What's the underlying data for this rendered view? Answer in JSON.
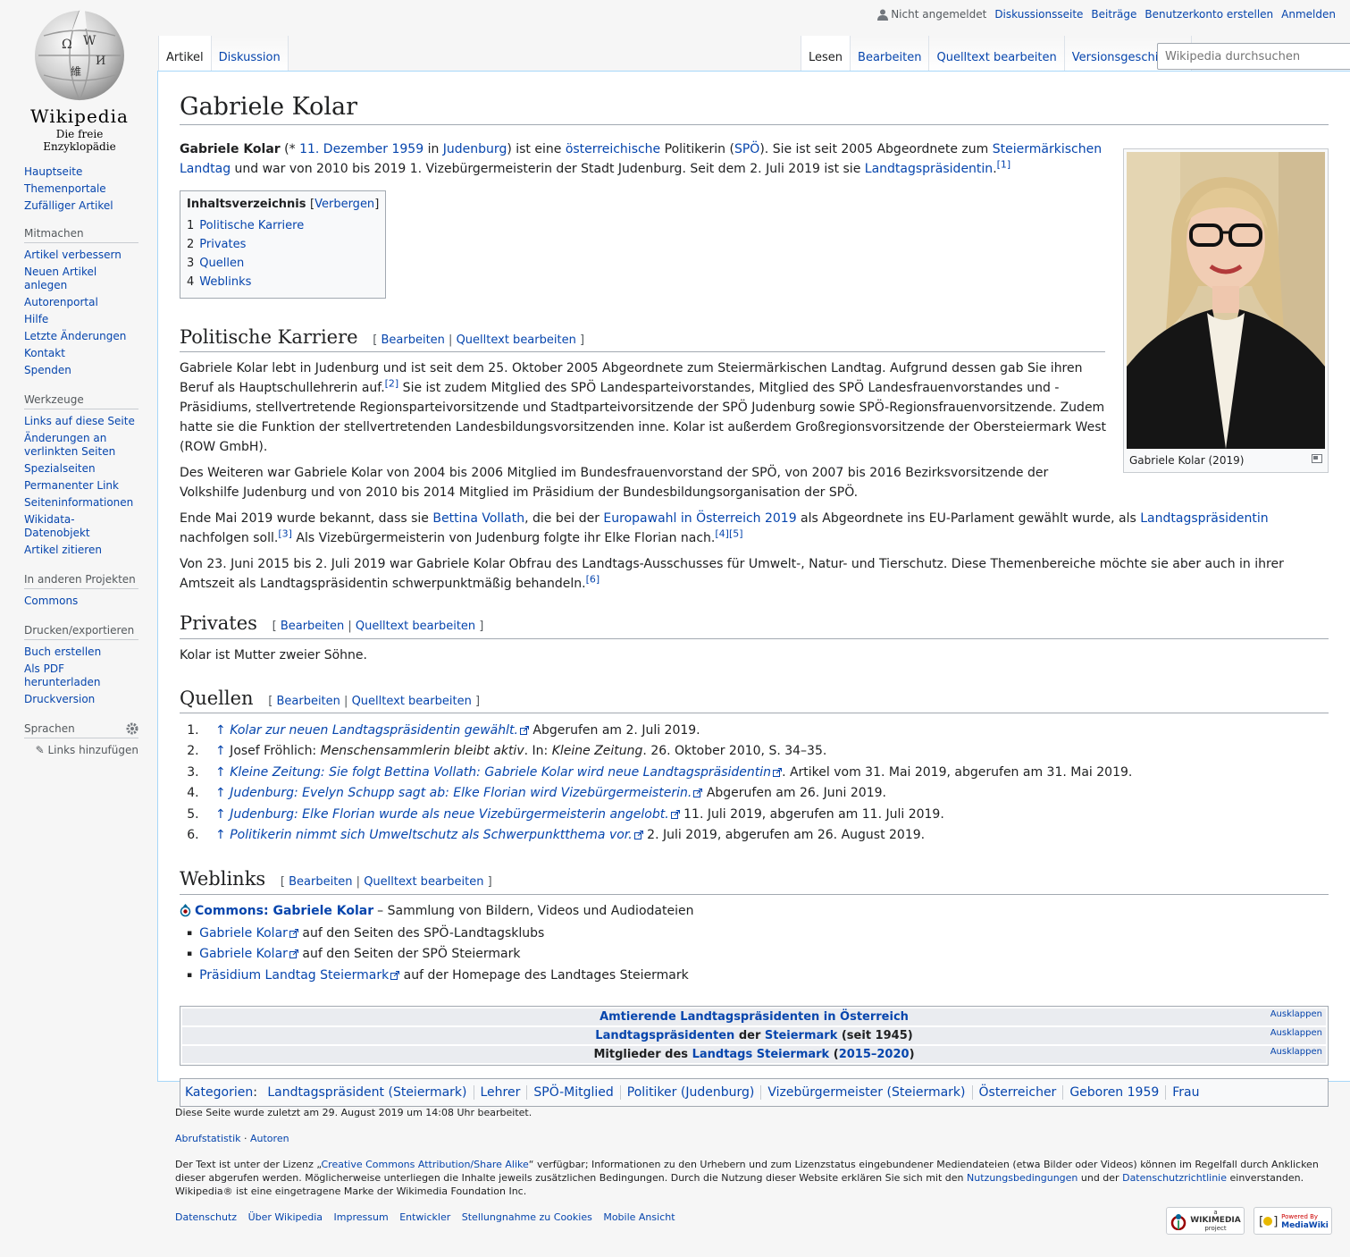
{
  "logo": {
    "wordmark": "Wikipedia",
    "tagline": "Die freie Enzyklopädie"
  },
  "personal": {
    "anon": "Nicht angemeldet",
    "links": [
      "Diskussionsseite",
      "Beiträge",
      "Benutzerkonto erstellen",
      "Anmelden"
    ]
  },
  "tabs_left": [
    "Artikel",
    "Diskussion"
  ],
  "tabs_right": [
    "Lesen",
    "Bearbeiten",
    "Quelltext bearbeiten",
    "Versionsgeschichte"
  ],
  "search": {
    "placeholder": "Wikipedia durchsuchen"
  },
  "sidebar": {
    "nav": [
      "Hauptseite",
      "Themenportale",
      "Zufälliger Artikel"
    ],
    "mitmachen": {
      "heading": "Mitmachen",
      "items": [
        "Artikel verbessern",
        "Neuen Artikel anlegen",
        "Autorenportal",
        "Hilfe",
        "Letzte Änderungen",
        "Kontakt",
        "Spenden"
      ]
    },
    "werkzeuge": {
      "heading": "Werkzeuge",
      "items": [
        "Links auf diese Seite",
        "Änderungen an verlinkten Seiten",
        "Spezialseiten",
        "Permanenter Link",
        "Seiteninformationen",
        "Wikidata-Datenobjekt",
        "Artikel zitieren"
      ]
    },
    "projekte": {
      "heading": "In anderen Projekten",
      "items": [
        "Commons"
      ]
    },
    "drucken": {
      "heading": "Drucken/exportieren",
      "items": [
        "Buch erstellen",
        "Als PDF herunterladen",
        "Druckversion"
      ]
    },
    "sprachen": {
      "heading": "Sprachen",
      "add": "Links hinzufügen"
    }
  },
  "article": {
    "title": "Gabriele Kolar",
    "intro": {
      "bold": "Gabriele Kolar",
      "t1": " (* ",
      "l1": "11. Dezember 1959",
      "t2": " in ",
      "l2": "Judenburg",
      "t3": ") ist eine ",
      "l3": "österreichische",
      "t4": " Politikerin (",
      "l4": "SPÖ",
      "t5": "). Sie ist seit 2005 Abgeordnete zum ",
      "l5": "Steiermärkischen Landtag",
      "t6": " und war von 2010 bis 2019 1. Vizebürgermeisterin der Stadt Judenburg. Seit dem 2. Juli 2019 ist sie ",
      "l6": "Landtagspräsidentin",
      "t7": ".",
      "ref": "[1]"
    },
    "image_caption": "Gabriele Kolar (2019)",
    "toc": {
      "title": "Inhaltsverzeichnis",
      "toggle": "Verbergen",
      "items": [
        {
          "num": "1",
          "label": "Politische Karriere"
        },
        {
          "num": "2",
          "label": "Privates"
        },
        {
          "num": "3",
          "label": "Quellen"
        },
        {
          "num": "4",
          "label": "Weblinks"
        }
      ]
    },
    "edit": {
      "open": "[ ",
      "edit": "Bearbeiten",
      "sep": " | ",
      "source": "Quelltext bearbeiten",
      "close": " ]"
    },
    "sections": {
      "karriere": {
        "title": "Politische Karriere",
        "p1a": "Gabriele Kolar lebt in Judenburg und ist seit dem 25. Oktober 2005 Abgeordnete zum Steiermärkischen Landtag. Aufgrund dessen gab Sie ihren Beruf als Hauptschullehrerin auf.",
        "p1ref": "[2]",
        "p1b": " Sie ist zudem Mitglied des SPÖ Landesparteivorstandes, Mitglied des SPÖ Landesfrauenvorstandes und -Präsidiums, stellvertretende Regionsparteivorsitzende und Stadtparteivorsitzende der SPÖ Judenburg sowie SPÖ-Regionsfrauenvorsitzende. Zudem hatte sie die Funktion der stellvertretenden Landesbildungsvorsitzenden inne. Kolar ist außerdem Großregionsvorsitzende der Obersteiermark West (ROW GmbH).",
        "p2": "Des Weiteren war Gabriele Kolar von 2004 bis 2006 Mitglied im Bundesfrauenvorstand der SPÖ, von 2007 bis 2016 Bezirksvorsitzende der Volkshilfe Judenburg und von 2010 bis 2014 Mitglied im Präsidium der Bundesbildungsorganisation der SPÖ.",
        "p3a": "Ende Mai 2019 wurde bekannt, dass sie ",
        "p3l1": "Bettina Vollath",
        "p3b": ", die bei der ",
        "p3l2": "Europawahl in Österreich 2019",
        "p3c": " als Abgeordnete ins EU-Parlament gewählt wurde, als ",
        "p3l3": "Landtagspräsidentin",
        "p3d": " nachfolgen soll.",
        "p3ref1": "[3]",
        "p3e": " Als Vizebürgermeisterin von Judenburg folgte ihr Elke Florian nach.",
        "p3ref2": "[4]",
        "p3ref3": "[5]",
        "p4": "Von 23. Juni 2015 bis 2. Juli 2019 war Gabriele Kolar Obfrau des Landtags-Ausschusses für Umwelt-, Natur- und Tierschutz. Diese Themenbereiche möchte sie aber auch in ihrer Amtszeit als Landtagspräsidentin schwerpunktmäßig behandeln.",
        "p4ref": "[6]"
      },
      "privates": {
        "title": "Privates",
        "text": "Kolar ist Mutter zweier Söhne."
      },
      "quellen": {
        "title": "Quellen",
        "refs": [
          {
            "arrow": "↑",
            "link": "Kolar zur neuen Landtagspräsidentin gewählt.",
            "rest": " Abgerufen am 2. Juli 2019."
          },
          {
            "arrow": "↑",
            "plain1": " Josef Fröhlich: ",
            "it1": "Menschensammlerin bleibt aktiv",
            "plain2": ". In: ",
            "it2": "Kleine Zeitung",
            "plain3": ". 26. Oktober 2010, S. 34–35."
          },
          {
            "arrow": "↑",
            "link": "Kleine Zeitung: Sie folgt Bettina Vollath: Gabriele Kolar wird neue Landtagspräsidentin",
            "rest": ". Artikel vom 31. Mai 2019, abgerufen am 31. Mai 2019."
          },
          {
            "arrow": "↑",
            "link": "Judenburg: Evelyn Schupp sagt ab: Elke Florian wird Vizebürgermeisterin.",
            "rest": " Abgerufen am 26. Juni 2019."
          },
          {
            "arrow": "↑",
            "link": "Judenburg: Elke Florian wurde als neue Vizebürgermeisterin angelobt.",
            "rest": " 11. Juli 2019, abgerufen am 11. Juli 2019."
          },
          {
            "arrow": "↑",
            "link": "Politikerin nimmt sich Umweltschutz als Schwerpunktthema vor.",
            "rest": " 2. Juli 2019, abgerufen am 26. August 2019."
          }
        ]
      },
      "weblinks": {
        "title": "Weblinks",
        "commons_link": "Commons: Gabriele Kolar",
        "commons_rest": " – Sammlung von Bildern, Videos und Audiodateien",
        "items": [
          {
            "link": "Gabriele Kolar",
            "rest": " auf den Seiten des SPÖ-Landtagsklubs"
          },
          {
            "link": "Gabriele Kolar",
            "rest": " auf den Seiten der SPÖ Steiermark"
          },
          {
            "link": "Präsidium Landtag Steiermark",
            "rest": " auf der Homepage des Landtages Steiermark"
          }
        ]
      }
    },
    "navboxes": {
      "toggle": "Ausklappen",
      "nb1": "Amtierende Landtagspräsidenten in Österreich",
      "nb2": {
        "l1": "Landtagspräsidenten",
        "t1": " der ",
        "l2": "Steiermark",
        "t2": " (seit 1945)"
      },
      "nb3": {
        "t1": "Mitglieder des ",
        "l1": "Landtags Steiermark",
        "t2": " (",
        "l2": "2015–2020",
        "t3": ")"
      }
    },
    "categories": {
      "label": "Kategorien",
      "colon": ":",
      "items": [
        "Landtagspräsident (Steiermark)",
        "Lehrer",
        "SPÖ-Mitglied",
        "Politiker (Judenburg)",
        "Vizebürgermeister (Steiermark)",
        "Österreicher",
        "Geboren 1959",
        "Frau"
      ]
    }
  },
  "footer": {
    "lastmod": "Diese Seite wurde zuletzt am 29. August 2019 um 14:08 Uhr bearbeitet.",
    "stats": "Abrufstatistik",
    "dot": " · ",
    "authors": "Autoren",
    "license1": "Der Text ist unter der Lizenz „",
    "license_link": "Creative Commons Attribution/Share Alike",
    "license2": "“ verfügbar; Informationen zu den Urhebern und zum Lizenzstatus eingebundener Mediendateien (etwa Bilder oder Videos) können im Regelfall durch Anklicken dieser abgerufen werden. Möglicherweise unterliegen die Inhalte jeweils zusätzlichen Bedingungen. Durch die Nutzung dieser Website erklären Sie sich mit den ",
    "terms": "Nutzungsbedingungen",
    "license3": " und der ",
    "privacy_link": "Datenschutzrichtlinie",
    "license4": " einverstanden.",
    "trademark": "Wikipedia® ist eine eingetragene Marke der Wikimedia Foundation Inc.",
    "links": [
      "Datenschutz",
      "Über Wikipedia",
      "Impressum",
      "Entwickler",
      "Stellungnahme zu Cookies",
      "Mobile Ansicht"
    ],
    "badge1": {
      "small": "a",
      "main": "WIKIMEDIA",
      "sub": "project"
    },
    "badge2": {
      "small": "Powered By",
      "main": "MediaWiki"
    }
  },
  "colors": {
    "link": "#0645ad",
    "border": "#a2a9b1",
    "tab_border": "#a7d7f9"
  }
}
